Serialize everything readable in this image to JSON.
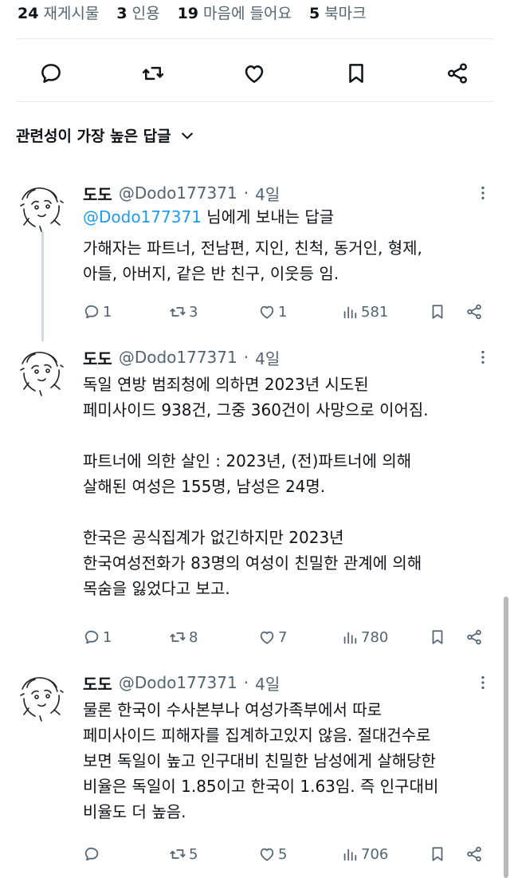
{
  "stats": [
    {
      "count": "24",
      "label": "재게시물"
    },
    {
      "count": "3",
      "label": "인용"
    },
    {
      "count": "19",
      "label": "마음에 들어요"
    },
    {
      "count": "5",
      "label": "북마크"
    }
  ],
  "action_icons": [
    "reply-icon",
    "repost-icon",
    "like-icon",
    "bookmark-icon",
    "share-icon"
  ],
  "sort": {
    "label": "관련성이 가장 높은 답글",
    "icon": "chevron-down-icon"
  },
  "replies": [
    {
      "name": "도도",
      "handle": "@Dodo177371",
      "dot": "·",
      "time": "4일",
      "replying_mention": "@Dodo177371",
      "replying_suffix": " 님에게 보내는 답글",
      "lines": [
        "가해자는 파트너, 전남편, 지인, 친척, 동거인, 형제,",
        "아들, 아버지, 같은 반 친구, 이웃등 임."
      ],
      "replies": "1",
      "reposts": "3",
      "likes": "1",
      "views": "581"
    },
    {
      "name": "도도",
      "handle": "@Dodo177371",
      "dot": "·",
      "time": "4일",
      "lines": [
        "독일 연방 범죄청에 의하면 2023년 시도된",
        "페미사이드 938건, 그중 360건이 사망으로 이어짐.",
        "",
        "파트너에 의한 살인 : 2023년, (전)파트너에 의해",
        "살해된 여성은 155명, 남성은 24명.",
        "",
        "한국은 공식집계가 없긴하지만 2023년",
        "한국여성전화가 83명의 여성이 친밀한 관계에 의해",
        "목숨을 잃었다고 보고."
      ],
      "replies": "1",
      "reposts": "8",
      "likes": "7",
      "views": "780"
    },
    {
      "name": "도도",
      "handle": "@Dodo177371",
      "dot": "·",
      "time": "4일",
      "lines": [
        "물론 한국이 수사본부나 여성가족부에서 따로",
        "페미사이드 피해자를 집계하고있지 않음. 절대건수로",
        "보면 독일이 높고 인구대비 친밀한 남성에게 살해당한",
        "비율은 독일이 1.85이고 한국이 1.63임. 즉 인구대비",
        "비율도 더 높음."
      ],
      "replies": "",
      "reposts": "5",
      "likes": "5",
      "views": "706"
    }
  ]
}
